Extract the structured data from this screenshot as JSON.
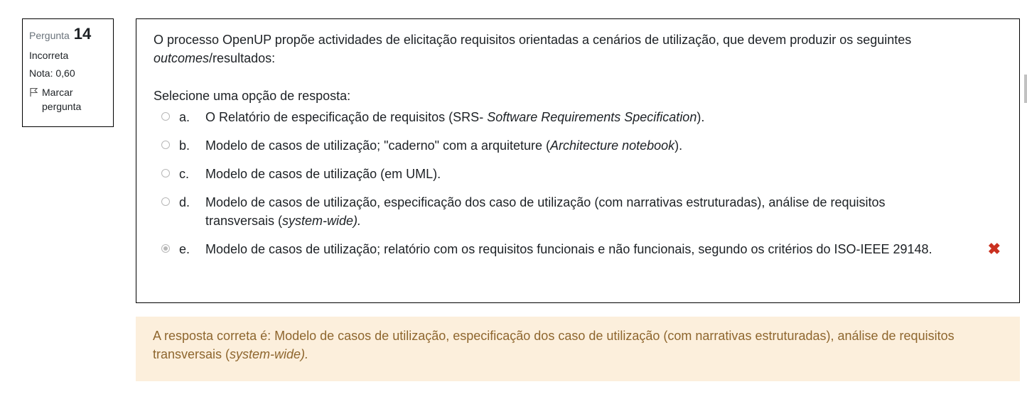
{
  "info": {
    "question_label": "Pergunta",
    "question_number": "14",
    "status": "Incorreta",
    "grade": "Nota: 0,60",
    "flag_label": "Marcar pergunta"
  },
  "question": {
    "text_part1": "O processo OpenUP propõe actividades de elicitação requisitos orientadas a cenários de utilização, que devem produzir os seguintes ",
    "text_italic": "outcomes",
    "text_part2": "/resultados:",
    "prompt": "Selecione uma opção de resposta:"
  },
  "options": [
    {
      "letter": "a.",
      "text": "O Relatório de especificação de requisitos (SRS- ",
      "italic": "Software Requirements Specification",
      "after": ").",
      "checked": false
    },
    {
      "letter": "b.",
      "text": "Modelo de casos de utilização; \"caderno\" com a arquiteture (",
      "italic": "Architecture notebook",
      "after": ").",
      "checked": false
    },
    {
      "letter": "c.",
      "text": "Modelo de casos de utilização (em UML).",
      "italic": "",
      "after": "",
      "checked": false
    },
    {
      "letter": "d.",
      "text": "Modelo de casos de utilização, especificação dos caso de utilização (com narrativas estruturadas), análise de requisitos transversais (",
      "italic": "system-wide).",
      "after": "",
      "checked": false
    },
    {
      "letter": "e.",
      "text": "Modelo de casos de utilização; relatório com os requisitos funcionais e não funcionais, segundo os critérios do ISO-IEEE 29148.",
      "italic": "",
      "after": "",
      "checked": true
    }
  ],
  "incorrect_mark": "✖",
  "feedback": {
    "text": "A resposta correta é: Modelo de casos de utilização, especificação dos caso de utilização (com narrativas estruturadas), análise de requisitos transversais (",
    "italic": "system-wide)."
  },
  "colors": {
    "feedback_bg": "#fcefdc",
    "feedback_text": "#8e662e",
    "incorrect": "#ca3120"
  }
}
